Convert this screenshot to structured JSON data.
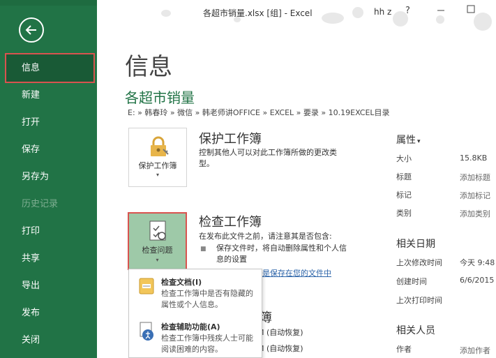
{
  "window": {
    "title": "各超市销量.xlsx  [组]  -  Excel",
    "user": "hh z",
    "help": "?"
  },
  "sidebar": {
    "items": [
      {
        "label": "信息"
      },
      {
        "label": "新建"
      },
      {
        "label": "打开"
      },
      {
        "label": "保存"
      },
      {
        "label": "另存为"
      },
      {
        "label": "历史记录"
      },
      {
        "label": "打印"
      },
      {
        "label": "共享"
      },
      {
        "label": "导出"
      },
      {
        "label": "发布"
      },
      {
        "label": "关闭"
      }
    ]
  },
  "page": {
    "title": "信息",
    "doc_title": "各超市销量",
    "breadcrumb": "E: » 韩春玲 » 微信 » 韩老师讲OFFICE » EXCEL » 要录 » 10.19EXCEL目录"
  },
  "protect": {
    "tile_label": "保护工作簿",
    "caret": "▾",
    "title": "保护工作簿",
    "desc": "控制其他人可以对此工作簿所做的更改类型。"
  },
  "inspect": {
    "tile_label": "检查问题",
    "caret": "▾",
    "title": "检查工作簿",
    "intro": "在发布此文件之前，请注意其是否包含:",
    "bullet": "保存文件时，将自动删除属性和个人信息的设置",
    "link": "是保存在您的文件中"
  },
  "dropdown": {
    "items": [
      {
        "title": "检查文档(I)",
        "desc": "检查工作簿中是否有隐藏的属性或个人信息。"
      },
      {
        "title": "检查辅助功能(A)",
        "desc": "检查工作簿中残疾人士可能阅读困难的内容。"
      }
    ]
  },
  "versions": {
    "title_fragment": "簿",
    "row1": "M (自动恢复)",
    "row2": "M (自动恢复)"
  },
  "properties": {
    "title": "属性",
    "title_caret": "▾",
    "rows": [
      {
        "label": "大小",
        "value": "15.8KB"
      },
      {
        "label": "标题",
        "value": "添加标题"
      },
      {
        "label": "标记",
        "value": "添加标记"
      },
      {
        "label": "类别",
        "value": "添加类别"
      }
    ],
    "dates_title": "相关日期",
    "dates": [
      {
        "label": "上次修改时间",
        "value": "今天 9:48"
      },
      {
        "label": "创建时间",
        "value": "6/6/2015"
      },
      {
        "label": "上次打印时间",
        "value": ""
      }
    ],
    "people_title": "相关人员",
    "people": [
      {
        "label": "作者",
        "value": "添加作者"
      }
    ]
  }
}
